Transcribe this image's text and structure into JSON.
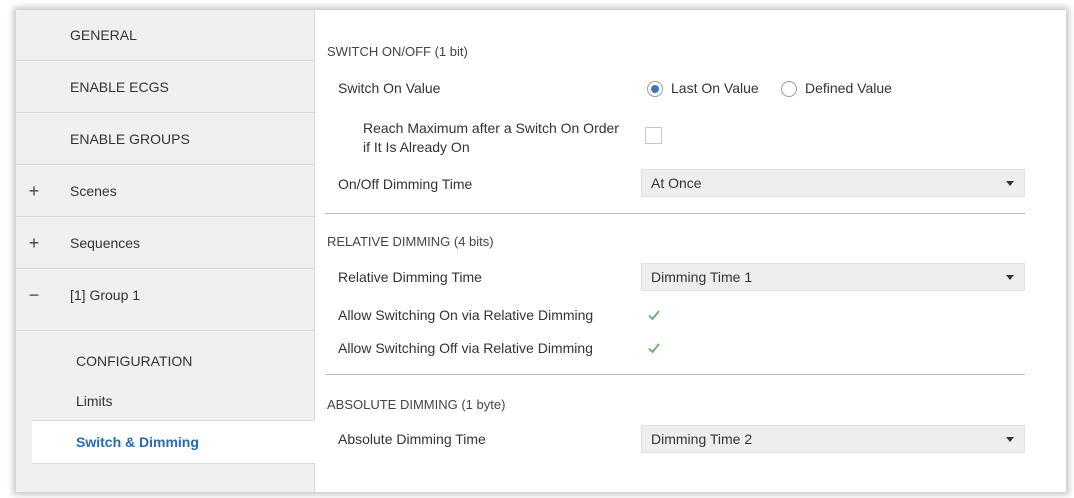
{
  "sidebar": {
    "items": [
      {
        "label": "GENERAL",
        "expander": ""
      },
      {
        "label": "ENABLE ECGS",
        "expander": ""
      },
      {
        "label": "ENABLE GROUPS",
        "expander": ""
      },
      {
        "label": "Scenes",
        "expander": "+"
      },
      {
        "label": "Sequences",
        "expander": "+"
      },
      {
        "label": "[1] Group 1",
        "expander": "−"
      }
    ],
    "subitems": [
      {
        "label": "CONFIGURATION"
      },
      {
        "label": "Limits"
      },
      {
        "label": "Switch & Dimming",
        "selected": true
      }
    ]
  },
  "main": {
    "switch_section": {
      "title": "SWITCH ON/OFF (1 bit)",
      "switch_on_value": {
        "label": "Switch On Value",
        "options": [
          "Last On Value",
          "Defined Value"
        ],
        "selected": "Last On Value"
      },
      "reach_max": {
        "label_line1": "Reach Maximum after a Switch On Order",
        "label_line2": "if It Is Already On",
        "checked": false
      },
      "onoff_dimming_time": {
        "label": "On/Off Dimming Time",
        "value": "At Once"
      }
    },
    "relative_section": {
      "title": "RELATIVE DIMMING (4 bits)",
      "dimming_time": {
        "label": "Relative Dimming Time",
        "value": "Dimming Time 1"
      },
      "allow_on": {
        "label": "Allow Switching On via Relative Dimming",
        "checked": true
      },
      "allow_off": {
        "label": "Allow Switching Off via Relative Dimming",
        "checked": true
      }
    },
    "absolute_section": {
      "title": "ABSOLUTE DIMMING (1 byte)",
      "dimming_time": {
        "label": "Absolute Dimming Time",
        "value": "Dimming Time 2"
      }
    }
  },
  "colors": {
    "accent": "#2b6aa8",
    "radio_dot": "#3f79b5",
    "check_green": "#6ab06a",
    "sidebar_bg": "#f0f0f0"
  }
}
